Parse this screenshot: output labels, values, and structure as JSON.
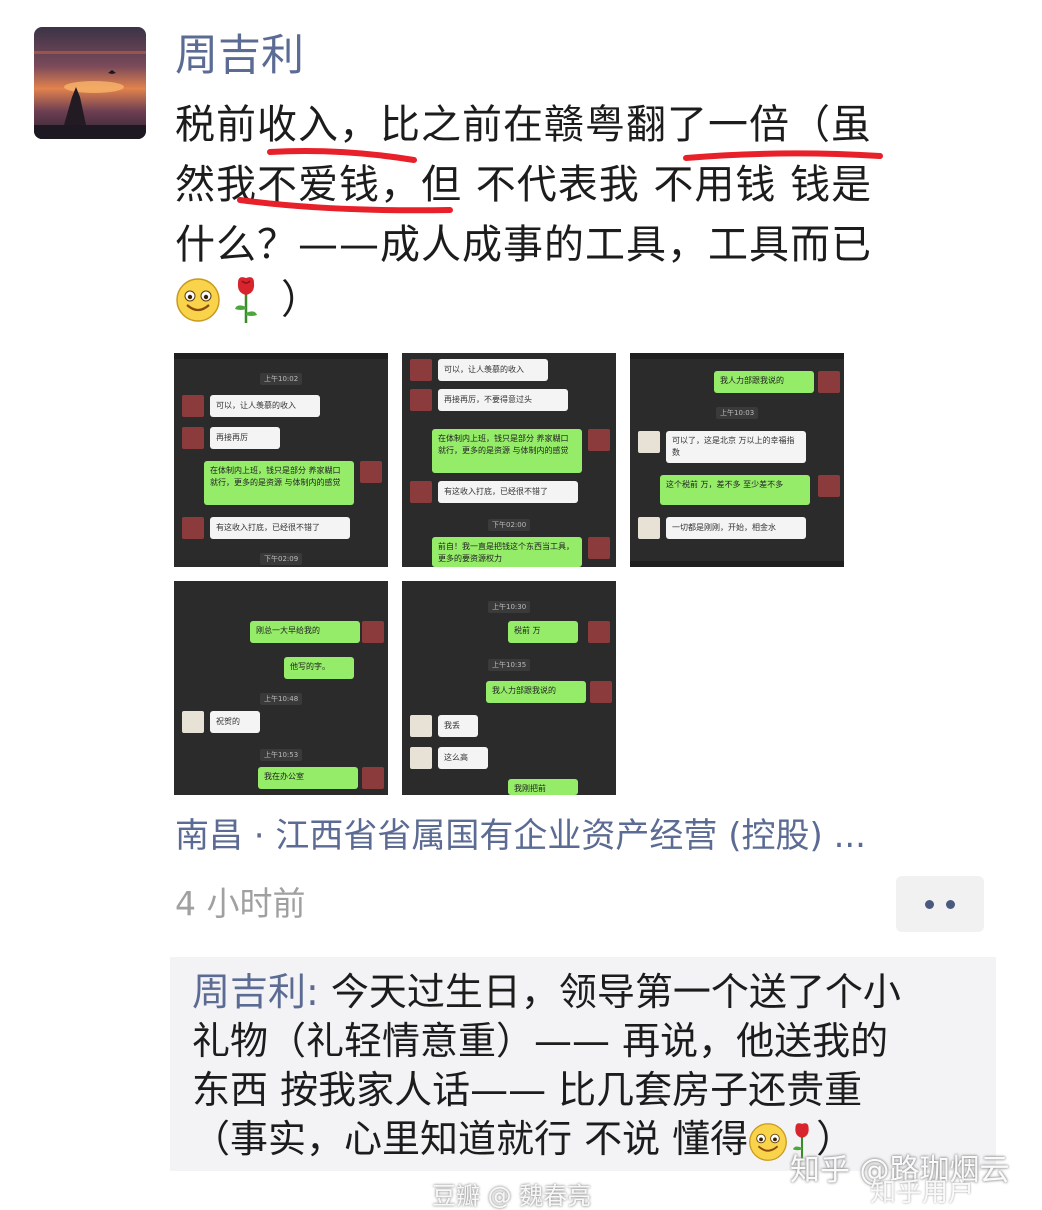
{
  "post": {
    "author": "周吉利",
    "content_lines": [
      "税前收入，比之前在赣粤翻了一倍（虽",
      "然我不爱钱，但 不代表我 不用钱  钱是",
      "什么？——成人成事的工具，工具而已"
    ],
    "content_tail": "）",
    "location": "南昌 · 江西省省属国有企业资产经营 (控股) ...",
    "time_ago": "4 小时前",
    "more_icon": "more-dots-icon"
  },
  "images": [
    {
      "messages": [
        "可以，让人羡慕的收入",
        "再接再厉",
        "在体制内上班，钱只是部分 养家糊口就行，更多的是资源 与体制内的感觉",
        "有这收入打底，已经很不错了"
      ],
      "times": [
        "上午10:02",
        "下午02:09"
      ]
    },
    {
      "messages": [
        "可以，让人羡慕的收入",
        "再接再厉，不要得意过头",
        "在体制内上班，钱只是部分 养家糊口就行，更多的是资源 与体制内的感觉",
        "有这收入打底，已经很不错了",
        "前自！我一直是把钱这个东西当工具，更多的要资源权力"
      ],
      "times": [
        "下午02:00"
      ]
    },
    {
      "messages": [
        "我人力部跟我说的",
        "可以了，这是北京 万以上的幸福指数",
        "这个税前   万，差不多 至少差不多",
        "一切都是刚刚，开始，相金水"
      ],
      "times": [
        "上午10:03"
      ]
    },
    {
      "messages": [
        "刚总一大早给我的",
        "他写的字。",
        "祝贺的",
        "我在办公室"
      ],
      "times": [
        "上午10:48",
        "上午10:53"
      ]
    },
    {
      "messages": [
        "税前   万",
        "我人力部跟我说的",
        "我丢",
        "这么高",
        "我刚把前"
      ],
      "times": [
        "上午10:30",
        "上午10:35"
      ]
    }
  ],
  "comment": {
    "author": "周吉利",
    "separator": ": ",
    "lines": [
      "今天过生日，领导第一个送了个小",
      "礼物（礼轻情意重）——  再说，他送我的",
      "东西   按我家人话—— 比几套房子还贵重",
      "（事实，心里知道就行    不说 懂得"
    ],
    "tail": "）"
  },
  "watermarks": {
    "douban": "豆瓣  @ 魏春亮",
    "zhihu": "知乎 @路珈烟云",
    "zhihu_user": "知乎用户"
  }
}
